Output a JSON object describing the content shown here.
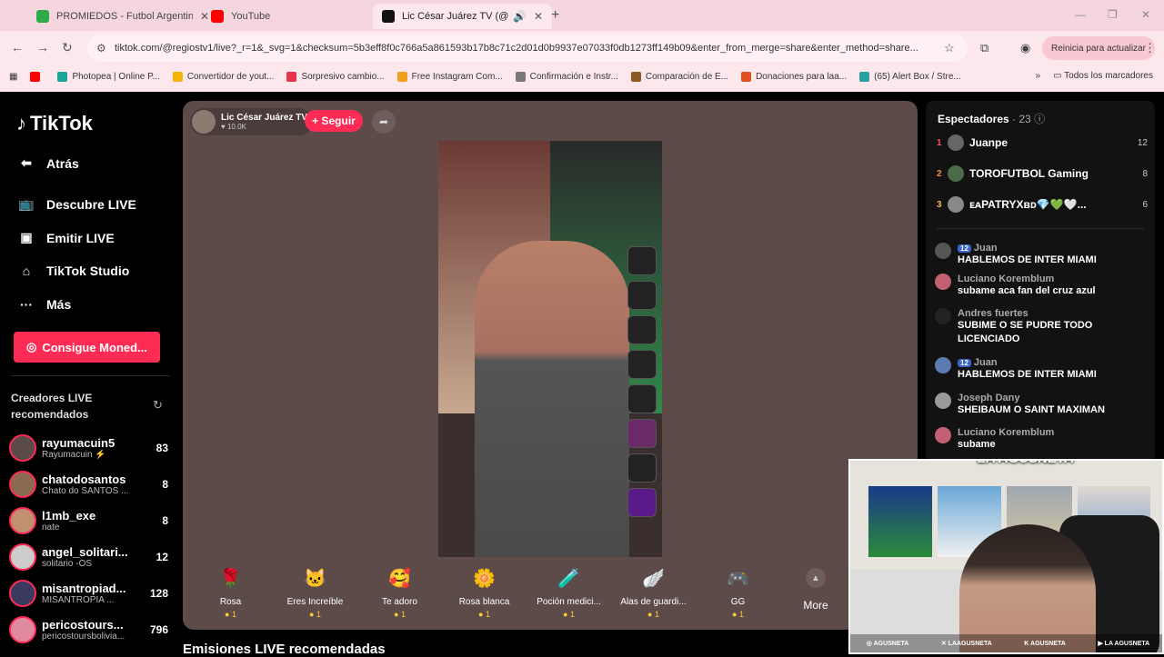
{
  "browser": {
    "tabs": [
      {
        "title": "PROMIEDOS - Futbol Argentino",
        "color": "#2eaa4a",
        "icon": "promiedos-icon"
      },
      {
        "title": "YouTube",
        "color": "#ff0000",
        "icon": "youtube-icon"
      },
      {
        "title": "Lic César Juárez TV (@regiostv1)",
        "color": "#111111",
        "icon": "tiktok-icon"
      }
    ],
    "url": "tiktok.com/@regiostv1/live?_r=1&_svg=1&checksum=5b3eff8f0c766a5a861593b17b8c71c2d01d0b9937e07033f0db1273ff149b09&enter_from_merge=share&enter_method=share...",
    "update_label": "Reinicia para actualizar",
    "bookmarks": [
      {
        "label": "",
        "color": "#ff0000",
        "icon": "youtube-icon"
      },
      {
        "label": "Photopea | Online P...",
        "color": "#18a497",
        "icon": "photopea-icon"
      },
      {
        "label": "Convertidor de yout...",
        "color": "#f5b400",
        "icon": "folder-icon"
      },
      {
        "label": "Sorpresivo cambio...",
        "color": "#e8334a",
        "icon": "news-icon"
      },
      {
        "label": "Free Instagram Com...",
        "color": "#f0a020",
        "icon": "bulb-icon"
      },
      {
        "label": "Confirmación e Instr...",
        "color": "#777777",
        "icon": "link-icon"
      },
      {
        "label": "Comparación de E...",
        "color": "#8a5a20",
        "icon": "site-icon"
      },
      {
        "label": "Donaciones para laa...",
        "color": "#e05020",
        "icon": "c-icon"
      },
      {
        "label": "(65) Alert Box / Stre...",
        "color": "#2aa0a0",
        "icon": "streamlabs-icon"
      }
    ],
    "all_bookmarks": "Todos los marcadores"
  },
  "sidebar": {
    "logo": "TikTok",
    "nav": [
      {
        "label": "Atrás",
        "icon": "back-arrow-icon"
      },
      {
        "label": "Descubre LIVE",
        "icon": "live-tv-icon"
      },
      {
        "label": "Emitir LIVE",
        "icon": "camera-icon"
      },
      {
        "label": "TikTok Studio",
        "icon": "studio-icon"
      },
      {
        "label": "Más",
        "icon": "more-dots-icon"
      }
    ],
    "coins_button": "Consigue Moned...",
    "creators_title": "Creadores LIVE recomendados",
    "creators": [
      {
        "name": "rayumacuin5",
        "sub": "Rayumacuin ⚡",
        "count": "83"
      },
      {
        "name": "chatodosantos",
        "sub": "Chato do SANTOS ...",
        "count": "8"
      },
      {
        "name": "l1mb_exe",
        "sub": "nate",
        "count": "8"
      },
      {
        "name": "angel_solitari...",
        "sub": "solitario -OS",
        "count": "12"
      },
      {
        "name": "misantropiad...",
        "sub": "MISANTROPIA ...",
        "count": "128"
      },
      {
        "name": "pericostours...",
        "sub": "pericostoursbolivia...",
        "count": "796"
      }
    ]
  },
  "stream": {
    "host_name": "Lic César Juárez TV",
    "host_likes": "♥ 10.0K",
    "follow_label": "+ Seguir",
    "gifts": [
      {
        "label": "Rosa",
        "price": "1",
        "emoji": "🌹"
      },
      {
        "label": "Eres Increíble",
        "price": "1",
        "emoji": "🐱"
      },
      {
        "label": "Te adoro",
        "price": "1",
        "emoji": "🥰"
      },
      {
        "label": "Rosa blanca",
        "price": "1",
        "emoji": "🌼"
      },
      {
        "label": "Poción medici...",
        "price": "1",
        "emoji": "🧪"
      },
      {
        "label": "Alas de guardi...",
        "price": "1",
        "emoji": "🪽"
      },
      {
        "label": "GG",
        "price": "1",
        "emoji": "🎮"
      }
    ],
    "more_label": "More",
    "recommended_label": "Emisiones LIVE recomendadas"
  },
  "panel": {
    "viewers_label": "Espectadores",
    "viewers_count": "· 23",
    "top_viewers": [
      {
        "rank": "1",
        "name": "Juanpe",
        "score": "12",
        "color": "#ff4d6d"
      },
      {
        "rank": "2",
        "name": "TOROFUTBOL Gaming",
        "score": "8",
        "color": "#ff8c42"
      },
      {
        "rank": "3",
        "name": "ᴇᴀPATRYXʙᴅ💎💚🤍...",
        "score": "6",
        "color": "#ffb347"
      }
    ],
    "chat": [
      {
        "user": "Juan",
        "msg": "HABLEMOS DE INTER MIAMI",
        "badge": "12"
      },
      {
        "user": "Luciano Koremblum",
        "msg": "subame aca fan del cruz azul",
        "badge": ""
      },
      {
        "user": "Andres fuertes",
        "msg": "SUBIME O SE PUDRE TODO LICENCIADO",
        "badge": ""
      },
      {
        "user": "Juan",
        "msg": "HABLEMOS DE INTER MIAMI",
        "badge": "12"
      },
      {
        "user": "Joseph Dany",
        "msg": "SHEIBAUM O SAINT MAXIMAN",
        "badge": ""
      },
      {
        "user": "Luciano Koremblum",
        "msg": "subame",
        "badge": ""
      }
    ]
  },
  "webcam": {
    "logo": "LA AGUSNETA",
    "socials": [
      "AGUSNETA",
      "LAAGUSNETA",
      "AGUSNETA",
      "LA AGUSNETA"
    ]
  }
}
